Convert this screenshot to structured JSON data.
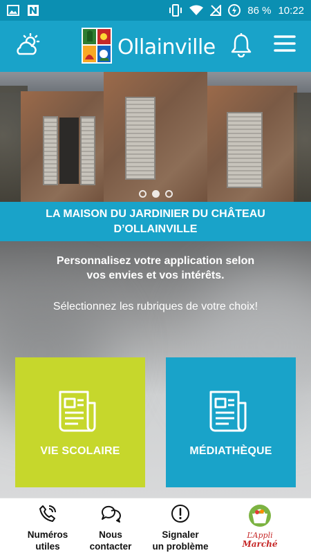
{
  "status_bar": {
    "battery": "86 %",
    "time": "10:22"
  },
  "header": {
    "title": "Ollainville"
  },
  "hero": {
    "caption": "LA MAISON DU JARDINIER DU CHÂTEAU D’OLLAINVILLE",
    "slide_count": 3,
    "active_slide": 2
  },
  "intro": {
    "line": "Personnalisez votre application selon vos envies et vos intérêts.",
    "choose": "Sélectionnez les rubriques de votre choix!"
  },
  "tiles": [
    {
      "label": "VIE SCOLAIRE",
      "color": "#c6d72c",
      "icon": "newspaper-icon"
    },
    {
      "label": "MÉDIATHÈQUE",
      "color": "#19a3c9",
      "icon": "newspaper-icon"
    }
  ],
  "bottom_nav": [
    {
      "label": "Numéros\nutiles",
      "icon": "phone-icon"
    },
    {
      "label": "Nous\ncontacter",
      "icon": "chat-bubbles-icon"
    },
    {
      "label": "Signaler\nun problème",
      "icon": "alert-icon"
    },
    {
      "line1": "L’Appli",
      "line2": "Marché",
      "icon": "market-basket-icon"
    }
  ],
  "colors": {
    "primary": "#19a3c9",
    "status_bar": "#0b8fb2",
    "accent_green": "#c6d72c"
  }
}
